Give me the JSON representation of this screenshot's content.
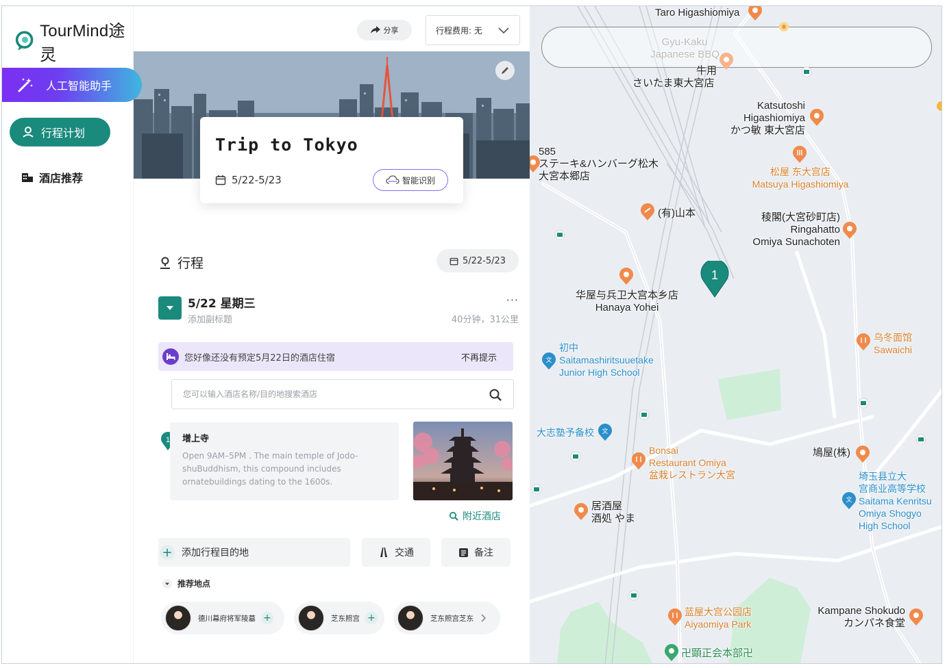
{
  "app": {
    "logo_text": "TourMind途灵"
  },
  "nav": {
    "ai_assistant": "人工智能助手",
    "trip_plan": "行程计划",
    "hotel_recommend": "酒店推荐"
  },
  "topbar": {
    "share_label": "分享",
    "cost_select_value": "行程费用: 无"
  },
  "hero": {
    "trip_title": "Trip to Tokyo",
    "trip_dates": "5/22-5/23",
    "smart_detect_label": "智能识别"
  },
  "itinerary": {
    "heading": "行程",
    "date_range": "5/22-5/23",
    "day": {
      "title": "5/22 星期三",
      "subtitle_placeholder": "添加副标题",
      "more": "···",
      "meta": "40分钟，31公里"
    },
    "hotel_alert": {
      "text": "您好像还没有预定5月22日的酒店住宿",
      "dismiss": "不再提示"
    },
    "hotel_search_placeholder": "您可以输入酒店名称/目的地搜索酒店",
    "poi": {
      "number": "1",
      "name": "增上寺",
      "description": "Open 9AM–5PM . The main temple of Jodo-shuBuddhism, this compound includes ornatebuildings dating to the 1600s.",
      "nearby_label": "附近酒店"
    },
    "actions": {
      "add_destination": "添加行程目的地",
      "transport": "交通",
      "notes": "备注"
    },
    "recommend": {
      "heading": "推荐地点",
      "chips": [
        "德川幕府将军陵墓",
        "芝东照宫",
        "芝东照宫芝东"
      ]
    }
  },
  "map": {
    "marker_number": "1",
    "labels": {
      "taro": "Taro Higashiomiya",
      "gyukaku_1": "Gyu-Kaku",
      "gyukaku_2": "Japanese BBQ",
      "gyuyo": "牛用",
      "saitama_higashi": "さいたま東大宮店",
      "katsutoshi_1": "Katsutoshi",
      "katsutoshi_2": "Higashiomiya",
      "katsutoshi_3": "かつ敏 東大宮店",
      "steak_1": "585",
      "steak_2": "ステーキ&ハンバーグ松木",
      "steak_3": "大宮本郷店",
      "matsuya_1": "松屋 东大宫店",
      "matsuya_2": "Matsuya Higashiomiya",
      "yamamoto": "(有)山本",
      "ringa_1": "稜閣(大宮砂町店)",
      "ringa_2": "Ringahatto",
      "ringa_3": "Omiya Sunachoten",
      "hanaya_1": "华屋与兵卫大宫本乡店",
      "hanaya_2": "Hanaya Yohei",
      "jhs_1": "初中",
      "jhs_2": "Saitamashiritsuuetake",
      "jhs_3": "Junior High School",
      "udon_1": "乌冬面馆",
      "udon_2": "Sawaichi",
      "taishi": "大志塾予备校",
      "bonsai_1": "Bonsai",
      "bonsai_2": "Restaurant Omiya",
      "bonsai_3": "盆栽レストラン大宮",
      "hatoya": "鳩屋(株)",
      "hs_1": "埼玉县立大",
      "hs_2": "宫商业高等学校",
      "hs_3": "Saitama Kenritsu",
      "hs_4": "Omiya Shogyo",
      "hs_5": "High School",
      "izakaya_1": "居酒屋",
      "izakaya_2": "酒処 やま",
      "aiya_1": "蓝屋大宫公园店",
      "aiya_2": "Aiyaomiya Park",
      "kampane_1": "Kampane Shokudo",
      "kampane_2": "カンパネ食堂",
      "kenshou": "卍顕正会本部卍"
    }
  },
  "colors": {
    "brand_teal": "#1a8a7c",
    "ai_gradient_start": "#7b2ff2",
    "ai_gradient_end": "#3fb6e0",
    "map_food_orange": "#f08a4b",
    "map_school_blue": "#2b8fc9",
    "map_park_green": "#cfeed8"
  }
}
